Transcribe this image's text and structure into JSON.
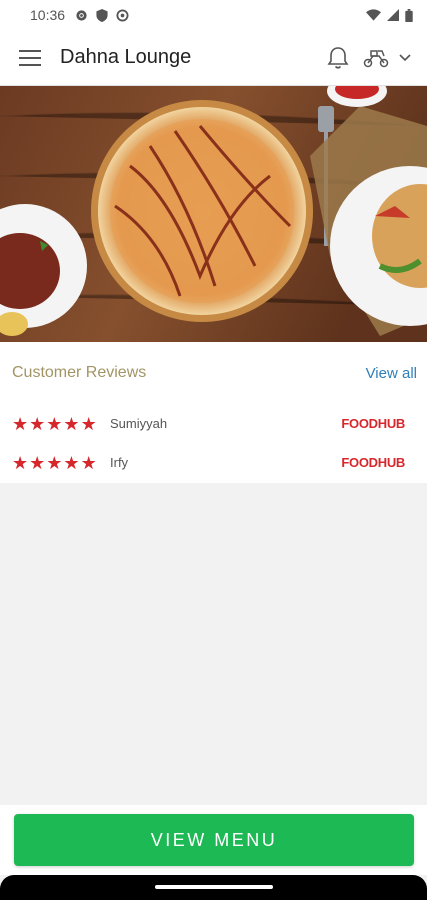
{
  "status_bar": {
    "time": "10:36",
    "left_icons": [
      "gear-icon",
      "shield-icon",
      "settings-icon"
    ],
    "right_icons": [
      "wifi-icon",
      "signal-icon",
      "battery-icon"
    ]
  },
  "app_bar": {
    "title": "Dahna Lounge",
    "icons": [
      "menu-icon",
      "bell-icon",
      "scooter-icon",
      "chevron-down-icon"
    ]
  },
  "hero": {
    "description_icon": "food-photo"
  },
  "reviews": {
    "title": "Customer Reviews",
    "view_all": "View all",
    "items": [
      {
        "rating": 5,
        "name": "Sumiyyah",
        "source": "FOODHUB"
      },
      {
        "rating": 5,
        "name": "Irfy",
        "source": "FOODHUB"
      }
    ]
  },
  "footer": {
    "button_label": "VIEW MENU"
  },
  "colors": {
    "accent_green": "#1db954",
    "star_red": "#d6282c",
    "link_blue": "#2f7fb8",
    "title_gold": "#a29565"
  }
}
